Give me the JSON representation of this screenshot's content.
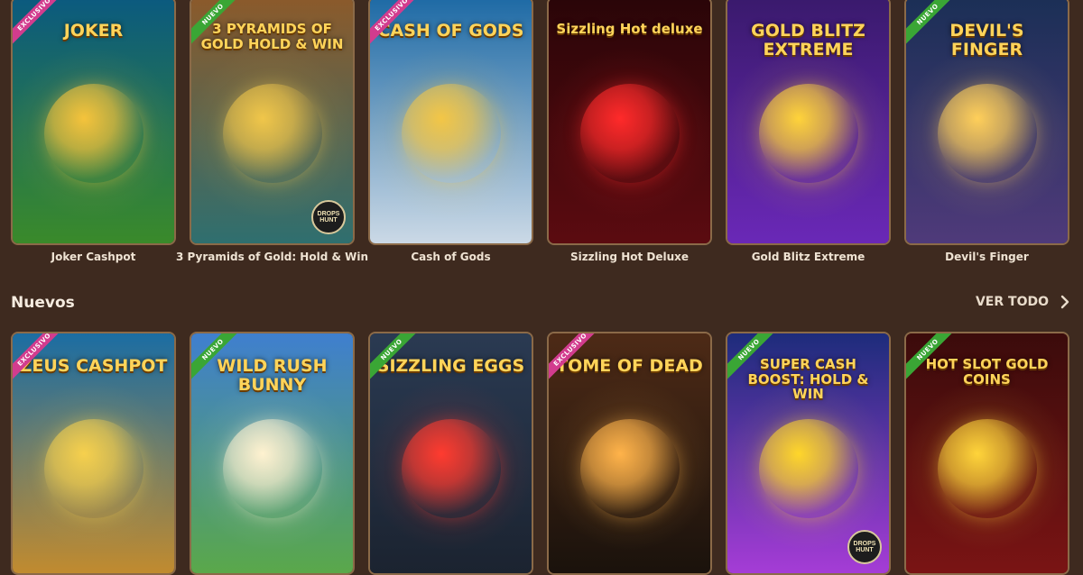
{
  "top_row": [
    {
      "title": "Joker Cashpot",
      "logo": "JOKER",
      "badge": "EXCLUSIVO",
      "badge_type": "excl",
      "bg": [
        "#0b5a7f",
        "#3a8a2a"
      ],
      "accent": "#f5c33b"
    },
    {
      "title": "3 Pyramids of Gold: Hold & Win",
      "logo": "3 PYRAMIDS OF GOLD HOLD & WIN",
      "badge": "NUEVO",
      "badge_type": "new",
      "bg": [
        "#8b5a2b",
        "#2f6f6f"
      ],
      "accent": "#f0c64a",
      "extra_badge": "DROPS HUNT"
    },
    {
      "title": "Cash of Gods",
      "logo": "CASH OF GODS",
      "badge": "EXCLUSIVO",
      "badge_type": "excl",
      "bg": [
        "#1e6aa5",
        "#cbd9e6"
      ],
      "accent": "#f3c646"
    },
    {
      "title": "Sizzling Hot Deluxe",
      "logo": "Sizzling Hot deluxe",
      "badge": "",
      "badge_type": "",
      "bg": [
        "#2a0508",
        "#5b0b10"
      ],
      "accent": "#ff2a2a"
    },
    {
      "title": "Gold Blitz Extreme",
      "logo": "GOLD BLITZ EXTREME",
      "badge": "",
      "badge_type": "",
      "bg": [
        "#3a1a6d",
        "#6a28b7"
      ],
      "accent": "#ffd33a"
    },
    {
      "title": "Devil's Finger",
      "logo": "DEVIL'S FINGER",
      "badge": "NUEVO",
      "badge_type": "new",
      "bg": [
        "#1b2f56",
        "#4f3a7a"
      ],
      "accent": "#ffcf5a"
    }
  ],
  "section": {
    "title": "Nuevos",
    "see_all": "VER TODO"
  },
  "bottom_row": [
    {
      "title": "Zeus Cashpot",
      "logo": "ZEUS CASHPOT",
      "badge": "EXCLUSIVO",
      "badge_type": "excl",
      "bg": [
        "#1b6da3",
        "#c18b2f"
      ],
      "accent": "#f6d04d"
    },
    {
      "title": "Wild Rush Bunny",
      "logo": "WILD RUSH BUNNY",
      "badge": "NUEVO",
      "badge_type": "new",
      "bg": [
        "#3f7fcf",
        "#5aa84a"
      ],
      "accent": "#fff2d0"
    },
    {
      "title": "Sizzling Eggs",
      "logo": "SIZZLING EGGS",
      "badge": "NUEVO",
      "badge_type": "new",
      "bg": [
        "#2a3a52",
        "#1b2330"
      ],
      "accent": "#ff3b2f"
    },
    {
      "title": "Tome of Dead",
      "logo": "TOME OF DEAD",
      "badge": "EXCLUSIVO",
      "badge_type": "excl",
      "bg": [
        "#4d2a16",
        "#1a120c"
      ],
      "accent": "#ffb34a"
    },
    {
      "title": "Super Cash Boost: Hold & Win",
      "logo": "SUPER CASH BOOST: HOLD & WIN",
      "badge": "NUEVO",
      "badge_type": "new",
      "bg": [
        "#1d2c7b",
        "#a53cd6"
      ],
      "accent": "#ffd62a",
      "extra_badge": "DROPS HUNT"
    },
    {
      "title": "Hot Slot Gold Coins",
      "logo": "HOT SLOT GOLD COINS",
      "badge": "NUEVO",
      "badge_type": "new",
      "bg": [
        "#3b0b0b",
        "#7a1414"
      ],
      "accent": "#ffd43a"
    }
  ],
  "icons": {
    "see_all": "chevron-right-icon"
  }
}
